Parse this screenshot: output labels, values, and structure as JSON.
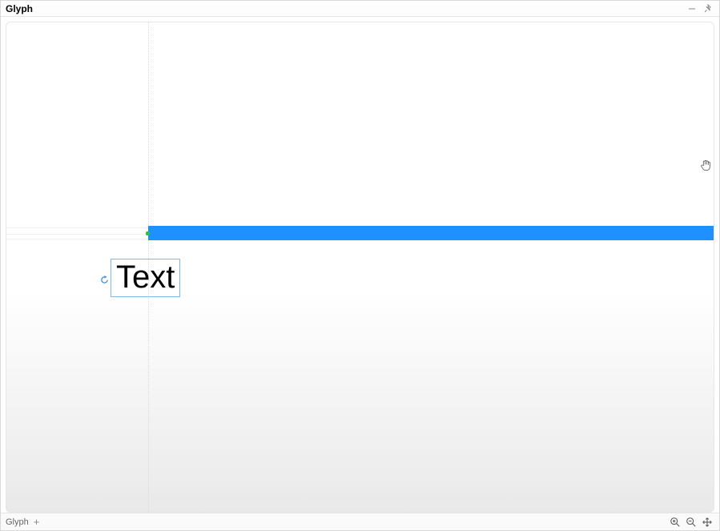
{
  "panel": {
    "title": "Glyph"
  },
  "canvas": {
    "text_value": "Text",
    "selection_color": "#7fb7e6",
    "shape_color": "#1e90ff",
    "anchor_color": "#2fbf4d"
  },
  "footer": {
    "tab_label": "Glyph",
    "add_tab_tooltip": "+"
  }
}
